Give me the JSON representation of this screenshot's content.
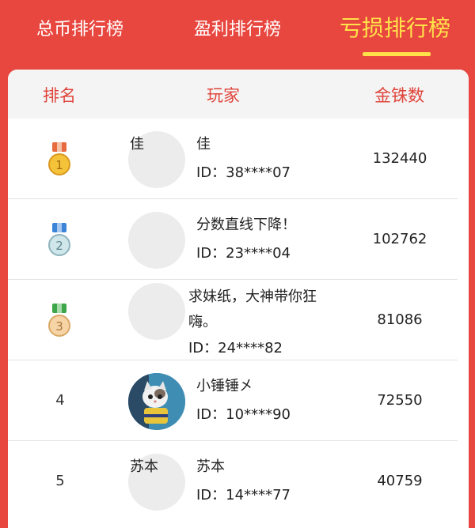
{
  "tabs": [
    {
      "label": "总币排行榜"
    },
    {
      "label": "盈利排行榜"
    },
    {
      "label": "亏损排行榜"
    }
  ],
  "table": {
    "headers": {
      "rank": "排名",
      "player": "玩家",
      "coins": "金铢数"
    },
    "rows": [
      {
        "rank": "1",
        "avatar_text": "佳",
        "name": "佳",
        "id": "ID：38****07",
        "coins": "132440"
      },
      {
        "rank": "2",
        "avatar_text": "",
        "name": "分数直线下降！",
        "id": "ID：23****04",
        "coins": "102762"
      },
      {
        "rank": "3",
        "avatar_text": "",
        "name": "求妹纸，大神带你狂嗨。",
        "id": "ID：24****82",
        "coins": "81086"
      },
      {
        "rank": "4",
        "avatar_text": "",
        "name": "小锤锤㐅",
        "id": "ID：10****90",
        "coins": "72550"
      },
      {
        "rank": "5",
        "avatar_text": "苏本",
        "name": "苏本",
        "id": "ID：14****77",
        "coins": "40759"
      }
    ]
  },
  "colors": {
    "brand_red": "#e8473f",
    "active_tab": "#ffe24a",
    "header_text": "#e0453c"
  }
}
